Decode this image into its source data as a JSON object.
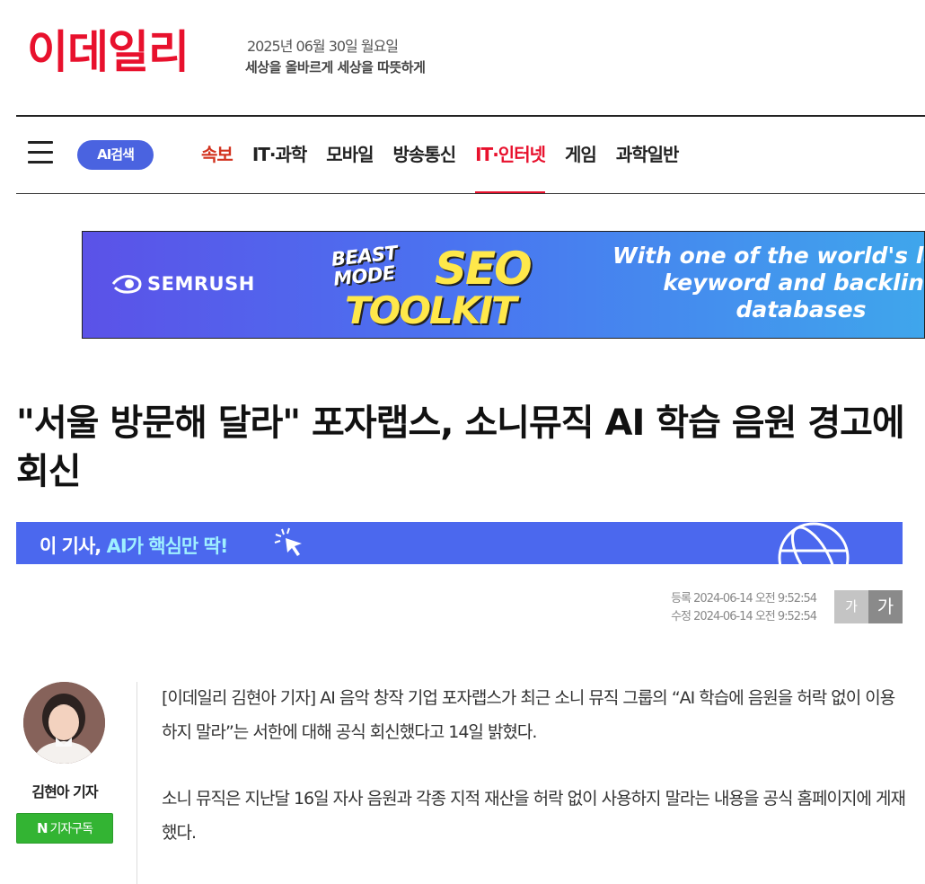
{
  "header": {
    "logo": "이데일리",
    "date": "2025년 06월 30일 월요일",
    "slogan": "세상을 올바르게 세상을 따뜻하게"
  },
  "nav": {
    "ai_search": "AI검색",
    "items": [
      {
        "label": "속보"
      },
      {
        "label": "IT·과학"
      },
      {
        "label": "모바일"
      },
      {
        "label": "방송통신"
      },
      {
        "label": "IT·인터넷"
      },
      {
        "label": "게임"
      },
      {
        "label": "과학일반"
      }
    ],
    "active": "IT·인터넷"
  },
  "ad": {
    "brand": "SEMRUSH",
    "beast_line1": "BEAST",
    "beast_line2": "MODE",
    "seo": "SEO",
    "toolkit": "TOOLKIT",
    "copy_line1": "With one of the world's larg",
    "copy_line2": "keyword and backlink",
    "copy_line3": "databases"
  },
  "article": {
    "headline": "\"서울 방문해 달라\" 포자랩스, 소니뮤직 AI 학습 음원 경고에 회신",
    "ai_summary_prefix": "이 기사, ",
    "ai_summary_highlight": "AI가 핵심만 딱!",
    "registered": "등록 2024-06-14 오전 9:52:54",
    "modified": "수정 2024-06-14 오전 9:52:54",
    "font_small": "가",
    "font_large": "가",
    "reporter": {
      "name": "김현아 기자",
      "subscribe_icon": "N",
      "subscribe_label": "기자구독"
    },
    "paragraphs": [
      "[이데일리 김현아 기자] AI 음악 창작 기업 포자랩스가 최근 소니 뮤직 그룹의 “AI 학습에 음원을 허락 없이 이용하지 말라”는 서한에 대해 공식 회신했다고 14일 밝혔다.",
      "소니 뮤직은 지난달 16일 자사 음원과 각종 지적 재산을 허락 없이 사용하지 말라는 내용을 공식 홈페이지에 게재했다."
    ]
  },
  "colors": {
    "brand_red": "#e8112d",
    "ai_blue": "#4b68ee",
    "subscribe_green": "#33b433"
  }
}
